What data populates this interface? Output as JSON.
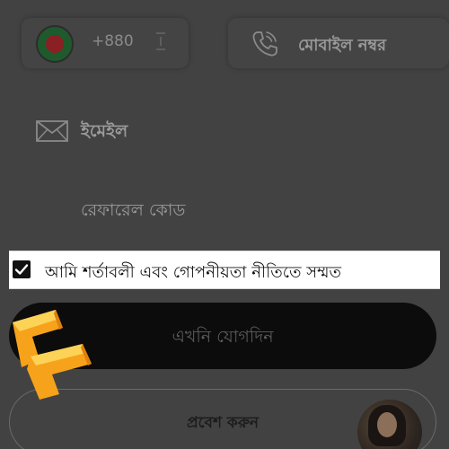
{
  "phone": {
    "country_code": "+880",
    "mobile_label": "মোবাইল নম্বর"
  },
  "email": {
    "label": "ইমেইল"
  },
  "referral": {
    "label": "রেফারেল কোড"
  },
  "agreement": {
    "checked": true,
    "label": "আমি শর্তাবলী এবং গোপনীয়তা নীতিতে সম্মত"
  },
  "buttons": {
    "join_label": "এখনি যোগদিন",
    "login_label": "প্রবেশ করুন"
  },
  "icons": {
    "flag": "bangladesh-flag-icon",
    "separator": "field-separator-icon",
    "phone": "phone-icon",
    "mail": "mail-icon",
    "check": "check-icon",
    "logo": "brand-logo-icon"
  },
  "colors": {
    "logo_orange": "#f7a21b",
    "logo_light": "#fcd257",
    "flag_green": "#1f5a2c",
    "flag_red": "#8a1f24",
    "join_button": "#0c0c0c"
  }
}
